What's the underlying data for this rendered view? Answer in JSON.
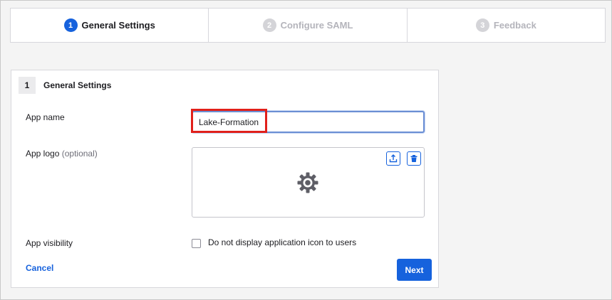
{
  "stepper": {
    "steps": [
      {
        "number": "1",
        "label": "General Settings",
        "state": "active"
      },
      {
        "number": "2",
        "label": "Configure SAML",
        "state": "inactive"
      },
      {
        "number": "3",
        "label": "Feedback",
        "state": "inactive"
      }
    ]
  },
  "card": {
    "step_number": "1",
    "title": "General Settings",
    "app_name": {
      "label": "App name",
      "value": "Lake-Formation"
    },
    "app_logo": {
      "label": "App logo",
      "optional": "(optional)",
      "icons": [
        "upload-icon",
        "trash-icon",
        "gear-icon"
      ]
    },
    "app_visibility": {
      "label": "App visibility",
      "checkbox_label": "Do not display application icon to users",
      "checked": false
    },
    "cancel_label": "Cancel",
    "next_label": "Next"
  },
  "colors": {
    "primary": "#1662dd",
    "highlight": "#e1201b"
  }
}
